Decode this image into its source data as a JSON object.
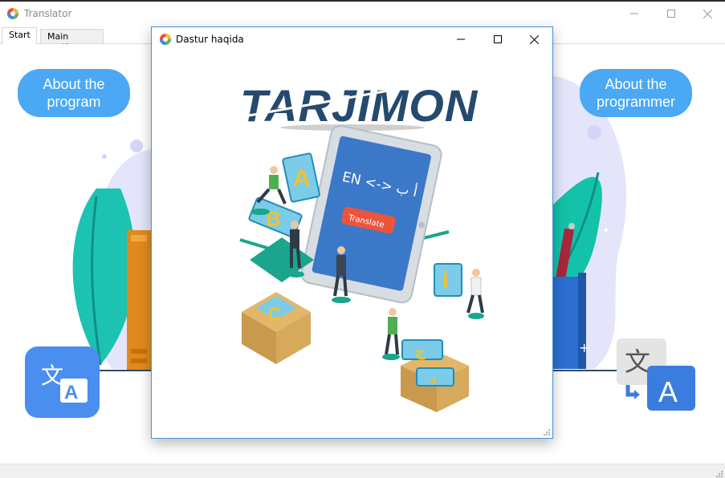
{
  "window": {
    "title": "Translator",
    "icon": "app-logo-icon",
    "controls": [
      "minimize-icon",
      "maximize-icon",
      "close-icon"
    ]
  },
  "tabs": [
    {
      "label": "Start",
      "active": true
    },
    {
      "label": "Main section",
      "active": false
    }
  ],
  "content": {
    "about_program_label": "About the program",
    "about_programmer_label": "About the programmer",
    "left_icon": "google-translate-icon",
    "right_icon": "translate-icon",
    "accent_color": "#4aa8f5"
  },
  "dialog": {
    "title": "Dastur haqida",
    "logo_text": "TARJIMON",
    "phone_text": "EN <-> أ ب",
    "phone_button": "Translate",
    "letters": [
      "A",
      "B",
      "C",
      "أ",
      "ج",
      "د"
    ]
  },
  "colors": {
    "brand_dark": "#254a6e",
    "brand_blue": "#4aa8f5",
    "teal": "#1aa58c"
  }
}
